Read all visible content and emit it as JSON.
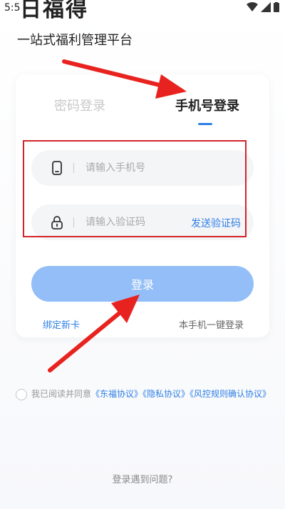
{
  "status_bar": {
    "time": "5:5"
  },
  "brand": {
    "title": "日福得",
    "subtitle": "一站式福利管理平台"
  },
  "tabs": {
    "password": "密码登录",
    "phone": "手机号登录"
  },
  "form": {
    "phone_placeholder": "请输入手机号",
    "code_placeholder": "请输入验证码",
    "send_code": "发送验证码"
  },
  "actions": {
    "login": "登录",
    "bind_card": "绑定新卡",
    "one_click": "本手机一键登录"
  },
  "agreement": {
    "prefix": "我已阅读并同意",
    "links": [
      "《东福协议》",
      "《隐私协议》",
      "《风控规则确认协议》"
    ]
  },
  "help": "登录遇到问题?",
  "colors": {
    "accent": "#2f7fe6",
    "login_button": "#93bef7",
    "annotation": "#d2242a"
  }
}
